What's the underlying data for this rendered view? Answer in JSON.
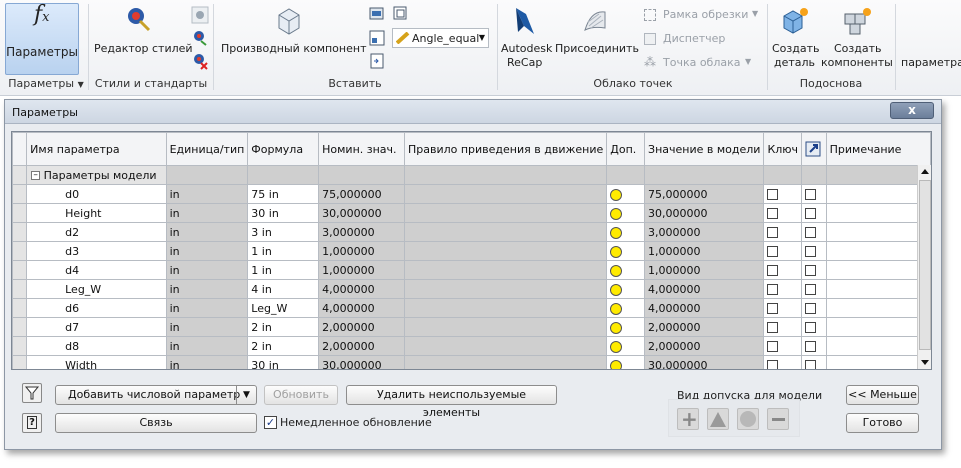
{
  "ribbon": {
    "params_button": "Параметры",
    "params_group": "Параметры",
    "style_editor": "Редактор стилей",
    "styles_group": "Стили и стандарты",
    "derived_component": "Производный компонент",
    "angle_combo": "Angle_equal",
    "insert_group": "Вставить",
    "recap_line1": "Autodesk",
    "recap_line2": "ReCap",
    "attach": "Присоединить",
    "clip_frame": "Рамка обрезки",
    "manager": "Диспетчер",
    "point_cloud_point": "Точка облака",
    "point_cloud_group": "Облако точек",
    "create_part_1": "Создать",
    "create_part_2": "деталь",
    "create_comp_1": "Создать",
    "create_comp_2": "компоненты",
    "base_group": "Подоснова",
    "params_cut": "параметра"
  },
  "dialog": {
    "title": "Параметры",
    "close": "x",
    "headers": {
      "name": "Имя параметра",
      "unit": "Единица/тип",
      "formula": "Формула",
      "nominal": "Номин. знач.",
      "motion_rule": "Правило приведения в движение",
      "tolerance": "Доп.",
      "model_value": "Значение в модели",
      "key": "Ключ",
      "comment": "Примечание"
    },
    "group_label": "Параметры модели",
    "group_toggle": "–",
    "rows": [
      {
        "name": "d0",
        "unit": "in",
        "formula": "75 in",
        "nominal": "75,000000",
        "model_value": "75,000000"
      },
      {
        "name": "Height",
        "unit": "in",
        "formula": "30 in",
        "nominal": "30,000000",
        "model_value": "30,000000"
      },
      {
        "name": "d2",
        "unit": "in",
        "formula": "3 in",
        "nominal": "3,000000",
        "model_value": "3,000000"
      },
      {
        "name": "d3",
        "unit": "in",
        "formula": "1 in",
        "nominal": "1,000000",
        "model_value": "1,000000"
      },
      {
        "name": "d4",
        "unit": "in",
        "formula": "1 in",
        "nominal": "1,000000",
        "model_value": "1,000000"
      },
      {
        "name": "Leg_W",
        "unit": "in",
        "formula": "4 in",
        "nominal": "4,000000",
        "model_value": "4,000000"
      },
      {
        "name": "d6",
        "unit": "in",
        "formula": "Leg_W",
        "nominal": "4,000000",
        "model_value": "4,000000"
      },
      {
        "name": "d7",
        "unit": "in",
        "formula": "2 in",
        "nominal": "2,000000",
        "model_value": "2,000000"
      },
      {
        "name": "d8",
        "unit": "in",
        "formula": "2 in",
        "nominal": "2,000000",
        "model_value": "2,000000"
      },
      {
        "name": "Width",
        "unit": "in",
        "formula": "30 in",
        "nominal": "30,000000",
        "model_value": "30,000000"
      }
    ],
    "add_numeric": "Добавить числовой параметр",
    "update": "Обновить",
    "delete_unused": "Удалить неиспользуемые элементы",
    "link": "Связь",
    "immediate_update": "Немедленное обновление",
    "tolerance_type_label": "Вид допуска для модели",
    "less": "<< Меньше",
    "done": "Готово"
  },
  "colors": {
    "tolerance_dot": "#ffeb00",
    "ribbon_active": "#c5dbf3",
    "column_gray": "#cfcfcf"
  }
}
